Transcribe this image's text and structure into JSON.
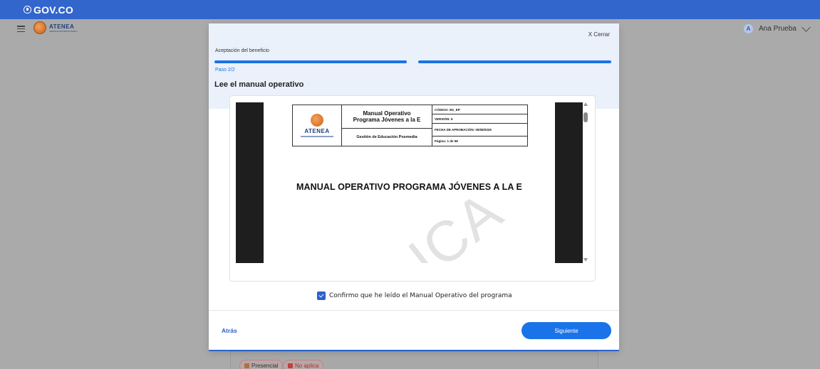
{
  "gov_bar": {
    "brand": "GOV.CO"
  },
  "app_header": {
    "logo_text": "ATENEA",
    "logo_subtext": "AGENCIA DISTRITAL PARA LA EDUCACIÓN SUPERIOR, LA CIENCIA Y LA TECNOLOGÍA",
    "user_initial": "A",
    "user_name": "Ana Prueba"
  },
  "modal": {
    "close_label": "X Cerrar",
    "step_title": "Aceptación del beneficio",
    "step_indicator": "Paso 2/2",
    "progress": {
      "total_steps": 2,
      "completed_steps": 2
    },
    "section_title": "Lee el manual operativo",
    "document": {
      "logo_text": "ATENEA",
      "title_line1": "Manual Operativo",
      "title_line2": "Programa Jóvenes a la E",
      "department": "Gestión de Educación Posmedia",
      "code": "CÓDIGO: M1_EP",
      "version": "VERSIÓN: 6",
      "approval_date": "FECHA DE APROBACIÓN: 05/08/2025",
      "page": "Página: 1 de 58",
      "heading": "MANUAL OPERATIVO PROGRAMA JÓVENES A LA E",
      "watermark": "ICA"
    },
    "confirm_label": "Confirmo que he leído el Manual Operativo del programa",
    "confirm_checked": true,
    "back_label": "Atrás",
    "next_label": "Siguiente"
  },
  "background_chips": [
    {
      "label": "Presencial",
      "icon": "presencial-icon"
    },
    {
      "label": "No aplica",
      "icon": "no-aplica-icon"
    }
  ],
  "colors": {
    "gov_blue": "#3366cc",
    "primary": "#1a73e8",
    "overlay": "#aaaaaa"
  }
}
